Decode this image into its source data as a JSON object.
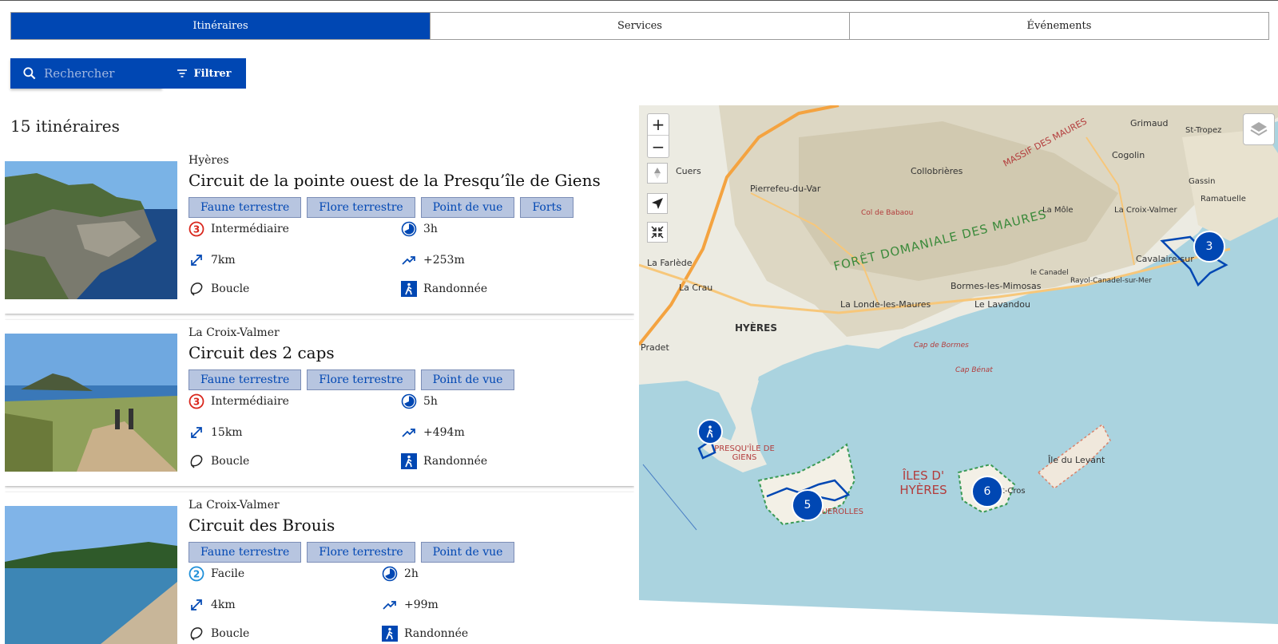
{
  "tabs": [
    {
      "label": "Itinéraires",
      "active": true
    },
    {
      "label": "Services",
      "active": false
    },
    {
      "label": "Événements",
      "active": false
    }
  ],
  "search": {
    "placeholder": "Rechercher"
  },
  "filter": {
    "label": "Filtrer"
  },
  "results": {
    "count_label": "15 itinéraires"
  },
  "cards": [
    {
      "location": "Hyères",
      "title": "Circuit de la pointe ouest de la Presqu’île de Giens",
      "tags": [
        "Faune terrestre",
        "Flore terrestre",
        "Point de vue",
        "Forts"
      ],
      "difficulty_level": "3",
      "difficulty": "Intermédiaire",
      "difficulty_color": "#d9261c",
      "duration": "3h",
      "distance": "7km",
      "elevation": "+253m",
      "route_type": "Boucle",
      "practice": "Randonnée"
    },
    {
      "location": "La Croix-Valmer",
      "title": "Circuit des 2 caps",
      "tags": [
        "Faune terrestre",
        "Flore terrestre",
        "Point de vue"
      ],
      "difficulty_level": "3",
      "difficulty": "Intermédiaire",
      "difficulty_color": "#d9261c",
      "duration": "5h",
      "distance": "15km",
      "elevation": "+494m",
      "route_type": "Boucle",
      "practice": "Randonnée"
    },
    {
      "location": "La Croix-Valmer",
      "title": "Circuit des Brouis",
      "tags": [
        "Faune terrestre",
        "Flore terrestre",
        "Point de vue"
      ],
      "difficulty_level": "2",
      "difficulty": "Facile",
      "difficulty_color": "#1e8fd8",
      "duration": "2h",
      "distance": "4km",
      "elevation": "+99m",
      "route_type": "Boucle",
      "practice": "Randonnée"
    }
  ],
  "map": {
    "zoom_in": "+",
    "zoom_out": "−",
    "clusters": [
      "3",
      "5",
      "6"
    ],
    "labels": {
      "foret": "FORÊT DOMANIALE DES MAURES",
      "massif": "MASSIF DES MAURES",
      "hyeres": "HYÈRES",
      "giens": "PRESQU'ÎLE DE GIENS",
      "iles": "ÎLES D' HYÈRES",
      "ile_levant": "Île du Levant",
      "port_cros": "Port-Cros",
      "porquerolles": "PORQUEROLLES",
      "pierrefeu": "Pierrefeu-du-Var",
      "collobrieres": "Collobrières",
      "cogolin": "Cogolin",
      "grimaud": "Grimaud",
      "la_mole": "La Môle",
      "la_croix_valmer": "La Croix-Valmer",
      "cavalaire": "Cavalaire-sur",
      "bormes": "Bormes-les-Mimosas",
      "lavandou": "Le Lavandou",
      "londe": "La Londe-les-Maures",
      "la_crau": "La Crau",
      "la_farlede": "La Farlède",
      "cuers": "Cuers",
      "gassin": "Gassin",
      "ramatuelle": "Ramatuelle",
      "st_tropez": "St-Tropez",
      "rayol": "Rayol-Canadel-sur-Mer",
      "le_canadel": "le Canadel",
      "pradet": "Pradet",
      "cap_benat": "Cap Bénat",
      "cap_bormes": "Cap de Bormes",
      "col_babaou": "Col de Babaou"
    }
  },
  "colors": {
    "brand": "#0047b3",
    "tag_bg": "#b7c5e0",
    "sea": "#aad3df"
  }
}
